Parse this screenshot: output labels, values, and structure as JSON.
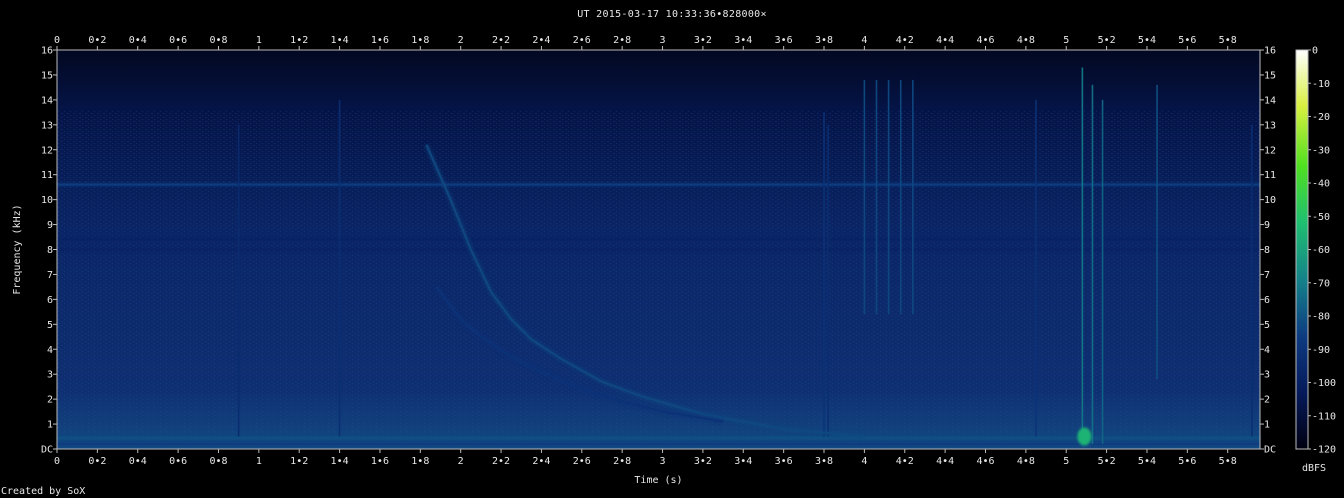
{
  "title": "UT 2015-03-17 10:33:36•828000×",
  "credit": "Created by SoX",
  "colorbar_unit": "dBFS",
  "chart_data": {
    "type": "heatmap",
    "title": "UT 2015-03-17 10:33:36•828000×",
    "xlabel": "Time (s)",
    "ylabel": "Frequency (kHz)",
    "xlim": [
      0,
      5.96
    ],
    "ylim": [
      0,
      16
    ],
    "x_ticks": [
      {
        "v": 0,
        "label": "0"
      },
      {
        "v": 0.2,
        "label": "0•2"
      },
      {
        "v": 0.4,
        "label": "0•4"
      },
      {
        "v": 0.6,
        "label": "0•6"
      },
      {
        "v": 0.8,
        "label": "0•8"
      },
      {
        "v": 1,
        "label": "1"
      },
      {
        "v": 1.2,
        "label": "1•2"
      },
      {
        "v": 1.4,
        "label": "1•4"
      },
      {
        "v": 1.6,
        "label": "1•6"
      },
      {
        "v": 1.8,
        "label": "1•8"
      },
      {
        "v": 2,
        "label": "2"
      },
      {
        "v": 2.2,
        "label": "2•2"
      },
      {
        "v": 2.4,
        "label": "2•4"
      },
      {
        "v": 2.6,
        "label": "2•6"
      },
      {
        "v": 2.8,
        "label": "2•8"
      },
      {
        "v": 3,
        "label": "3"
      },
      {
        "v": 3.2,
        "label": "3•2"
      },
      {
        "v": 3.4,
        "label": "3•4"
      },
      {
        "v": 3.6,
        "label": "3•6"
      },
      {
        "v": 3.8,
        "label": "3•8"
      },
      {
        "v": 4,
        "label": "4"
      },
      {
        "v": 4.2,
        "label": "4•2"
      },
      {
        "v": 4.4,
        "label": "4•4"
      },
      {
        "v": 4.6,
        "label": "4•6"
      },
      {
        "v": 4.8,
        "label": "4•8"
      },
      {
        "v": 5,
        "label": "5"
      },
      {
        "v": 5.2,
        "label": "5•2"
      },
      {
        "v": 5.4,
        "label": "5•4"
      },
      {
        "v": 5.6,
        "label": "5•6"
      },
      {
        "v": 5.8,
        "label": "5•8"
      }
    ],
    "y_ticks": [
      {
        "v": 0,
        "label": "DC"
      },
      {
        "v": 1,
        "label": "1"
      },
      {
        "v": 2,
        "label": "2"
      },
      {
        "v": 3,
        "label": "3"
      },
      {
        "v": 4,
        "label": "4"
      },
      {
        "v": 5,
        "label": "5"
      },
      {
        "v": 6,
        "label": "6"
      },
      {
        "v": 7,
        "label": "7"
      },
      {
        "v": 8,
        "label": "8"
      },
      {
        "v": 9,
        "label": "9"
      },
      {
        "v": 10,
        "label": "10"
      },
      {
        "v": 11,
        "label": "11"
      },
      {
        "v": 12,
        "label": "12"
      },
      {
        "v": 13,
        "label": "13"
      },
      {
        "v": 14,
        "label": "14"
      },
      {
        "v": 15,
        "label": "15"
      },
      {
        "v": 16,
        "label": "16"
      }
    ],
    "colorbar": {
      "label": "dBFS",
      "range": [
        -120,
        0
      ],
      "ticks": [
        {
          "v": 0,
          "label": "0"
        },
        {
          "v": -10,
          "label": "-10"
        },
        {
          "v": -20,
          "label": "-20"
        },
        {
          "v": -30,
          "label": "-30"
        },
        {
          "v": -40,
          "label": "-40"
        },
        {
          "v": -50,
          "label": "-50"
        },
        {
          "v": -60,
          "label": "-60"
        },
        {
          "v": -70,
          "label": "-70"
        },
        {
          "v": -80,
          "label": "-80"
        },
        {
          "v": -90,
          "label": "-90"
        },
        {
          "v": -100,
          "label": "-100"
        },
        {
          "v": -110,
          "label": "-110"
        },
        {
          "v": -120,
          "label": "-120"
        }
      ],
      "colors": [
        "#000010",
        "#051a5a",
        "#0d3a80",
        "#14808a",
        "#1fc070",
        "#50e020",
        "#d8f040",
        "#ffffff"
      ]
    },
    "features": {
      "background_level_dbfs": -100,
      "horizontal_lines": [
        {
          "freq_khz": 10.6,
          "level_dbfs": -85
        },
        {
          "freq_khz": 8.4,
          "level_dbfs": -98
        },
        {
          "freq_khz": 8.0,
          "level_dbfs": -98
        },
        {
          "freq_khz": 0.45,
          "level_dbfs": -80
        },
        {
          "freq_khz": 0.2,
          "level_dbfs": -85
        }
      ],
      "whistler_tracks": [
        {
          "points": [
            [
              1.83,
              12.2
            ],
            [
              1.95,
              10.0
            ],
            [
              2.05,
              8.0
            ],
            [
              2.15,
              6.3
            ],
            [
              2.25,
              5.2
            ],
            [
              2.35,
              4.4
            ],
            [
              2.5,
              3.6
            ],
            [
              2.7,
              2.7
            ],
            [
              2.9,
              2.1
            ],
            [
              3.2,
              1.4
            ],
            [
              3.6,
              0.8
            ],
            [
              4.0,
              0.5
            ]
          ],
          "level_dbfs": -82
        },
        {
          "points": [
            [
              1.88,
              6.5
            ],
            [
              2.0,
              5.2
            ],
            [
              2.1,
              4.5
            ],
            [
              2.25,
              3.7
            ],
            [
              2.4,
              3.1
            ],
            [
              2.6,
              2.4
            ],
            [
              2.8,
              1.9
            ],
            [
              3.0,
              1.5
            ],
            [
              3.3,
              1.1
            ]
          ],
          "level_dbfs": -90
        }
      ],
      "vertical_bursts": [
        {
          "t": 0.9,
          "f_from": 0.5,
          "f_to": 13.0,
          "level_dbfs": -93
        },
        {
          "t": 1.4,
          "f_from": 0.5,
          "f_to": 14.0,
          "level_dbfs": -92
        },
        {
          "t": 3.8,
          "f_from": 0.5,
          "f_to": 13.5,
          "level_dbfs": -90
        },
        {
          "t": 3.82,
          "f_from": 0.5,
          "f_to": 13.0,
          "level_dbfs": -92
        },
        {
          "t": 4.0,
          "f_from": 5.4,
          "f_to": 14.8,
          "level_dbfs": -82
        },
        {
          "t": 4.06,
          "f_from": 5.4,
          "f_to": 14.8,
          "level_dbfs": -82
        },
        {
          "t": 4.12,
          "f_from": 5.4,
          "f_to": 14.8,
          "level_dbfs": -82
        },
        {
          "t": 4.18,
          "f_from": 5.4,
          "f_to": 14.8,
          "level_dbfs": -82
        },
        {
          "t": 4.24,
          "f_from": 5.4,
          "f_to": 14.8,
          "level_dbfs": -82
        },
        {
          "t": 4.85,
          "f_from": 0.5,
          "f_to": 14.0,
          "level_dbfs": -90
        },
        {
          "t": 5.08,
          "f_from": 0.2,
          "f_to": 15.3,
          "level_dbfs": -70
        },
        {
          "t": 5.13,
          "f_from": 0.2,
          "f_to": 14.6,
          "level_dbfs": -72
        },
        {
          "t": 5.18,
          "f_from": 0.2,
          "f_to": 14.0,
          "level_dbfs": -75
        },
        {
          "t": 5.45,
          "f_from": 2.8,
          "f_to": 14.6,
          "level_dbfs": -80
        },
        {
          "t": 5.92,
          "f_from": 0.5,
          "f_to": 13.0,
          "level_dbfs": -92
        }
      ],
      "low_freq_hotspot": {
        "t": 5.09,
        "freq_khz": 0.5,
        "level_dbfs": -55
      }
    }
  }
}
